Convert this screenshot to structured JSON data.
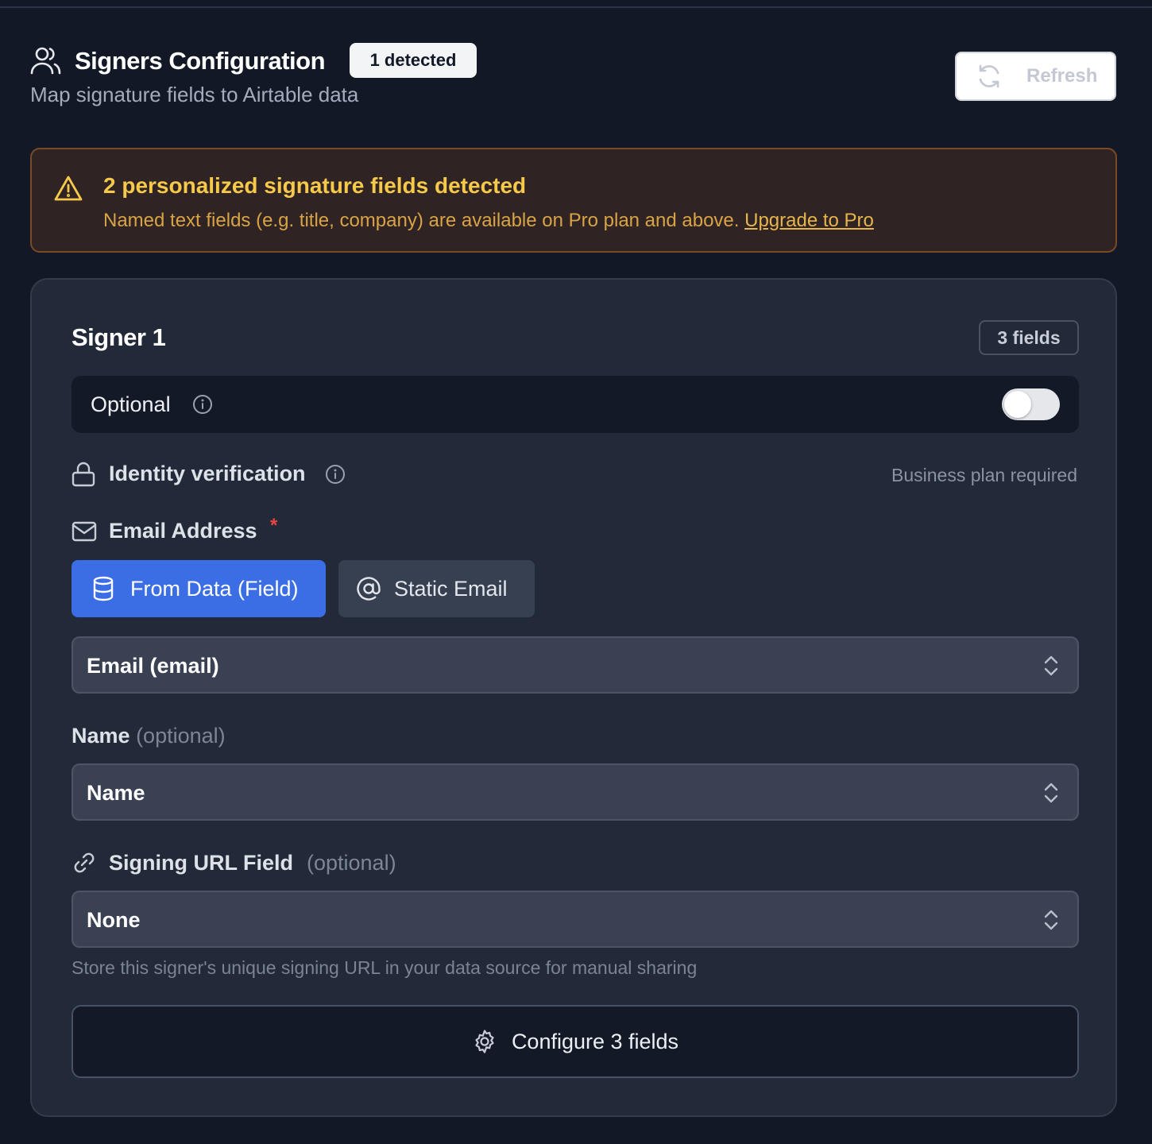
{
  "header": {
    "title": "Signers Configuration",
    "badge": "1 detected",
    "subtitle": "Map signature fields to Airtable data",
    "refresh_label": "Refresh",
    "icon": "users-icon"
  },
  "warning": {
    "icon": "warning-triangle-icon",
    "title": "2 personalized signature fields detected",
    "body": "Named text fields (e.g. title, company) are available on Pro plan and above. ",
    "link": "Upgrade to Pro"
  },
  "signer": {
    "title": "Signer 1",
    "fields_badge": "3 fields",
    "optional": {
      "label": "Optional",
      "enabled": false
    },
    "identity": {
      "label": "Identity verification",
      "note": "Business plan required",
      "icon": "lock-icon"
    },
    "email": {
      "label": "Email Address",
      "required_mark": "*",
      "icon": "mail-icon",
      "mode_options": [
        {
          "label": "From Data (Field)",
          "icon": "database-icon",
          "selected": true
        },
        {
          "label": "Static Email",
          "icon": "at-sign-icon",
          "selected": false
        }
      ],
      "selected": "Email (email)"
    },
    "name": {
      "label": "Name",
      "optional": "(optional)",
      "selected": "Name"
    },
    "signing_url": {
      "label": "Signing URL Field",
      "optional": "(optional)",
      "icon": "link-icon",
      "selected": "None",
      "helper": "Store this signer's unique signing URL in your data source for manual sharing"
    },
    "configure_label": "Configure 3 fields"
  },
  "colors": {
    "background": "#121826",
    "card": "#222938",
    "accent": "#3b6de5",
    "warning_text": "#f7c94a",
    "warning_border": "#7a4a23",
    "required": "#ef4444"
  }
}
